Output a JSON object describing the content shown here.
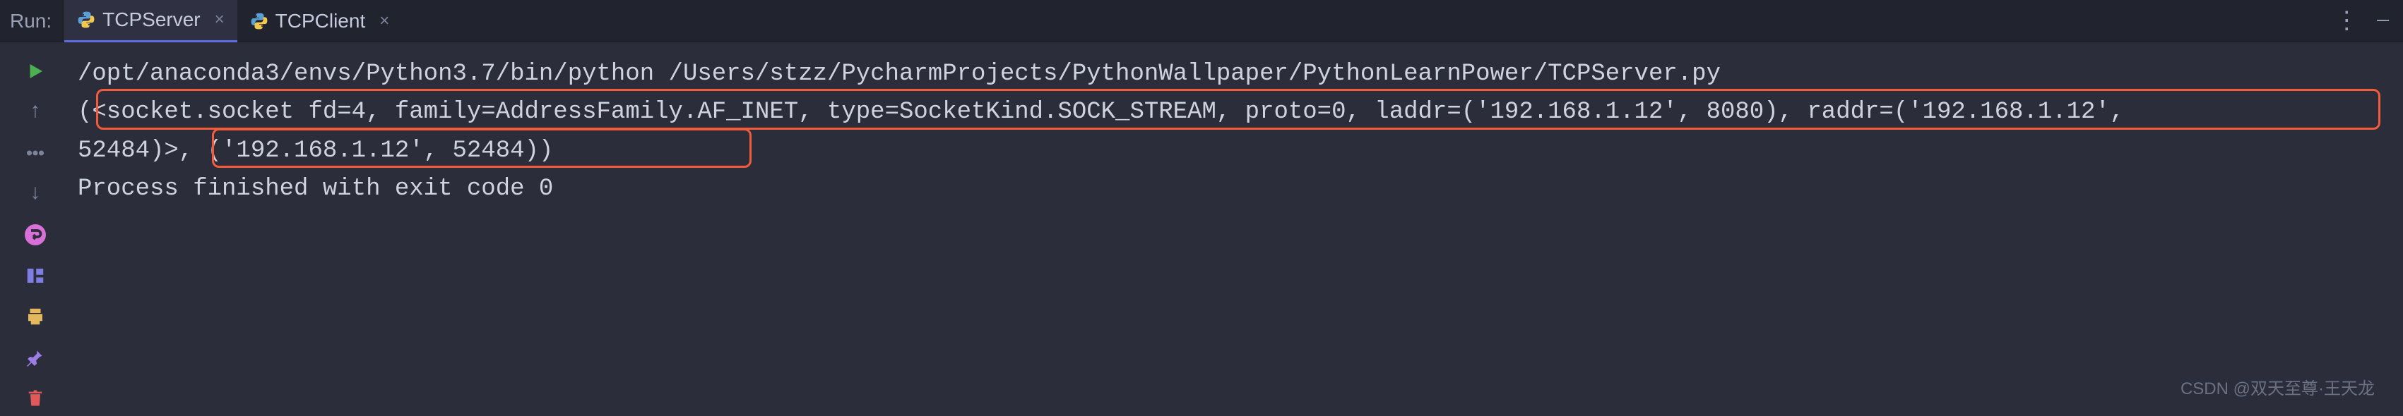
{
  "tabbar": {
    "run_label": "Run:",
    "tabs": [
      {
        "label": "TCPServer",
        "active": true
      },
      {
        "label": "TCPClient",
        "active": false
      }
    ],
    "more_icon": "⋮"
  },
  "sidebar": {
    "buttons": [
      "play",
      "up",
      "stop-dots",
      "down",
      "wrap",
      "print",
      "pin",
      "trash"
    ]
  },
  "console": {
    "lines": [
      "/opt/anaconda3/envs/Python3.7/bin/python /Users/stzz/PycharmProjects/PythonWallpaper/PythonLearnPower/TCPServer.py",
      "(<socket.socket fd=4, family=AddressFamily.AF_INET, type=SocketKind.SOCK_STREAM, proto=0, laddr=('192.168.1.12', 8080), raddr=('192.168.1.12', ",
      "52484)>, ('192.168.1.12', 52484))",
      "",
      "Process finished with exit code 0"
    ]
  },
  "watermark": "CSDN @双天至尊·王天龙"
}
